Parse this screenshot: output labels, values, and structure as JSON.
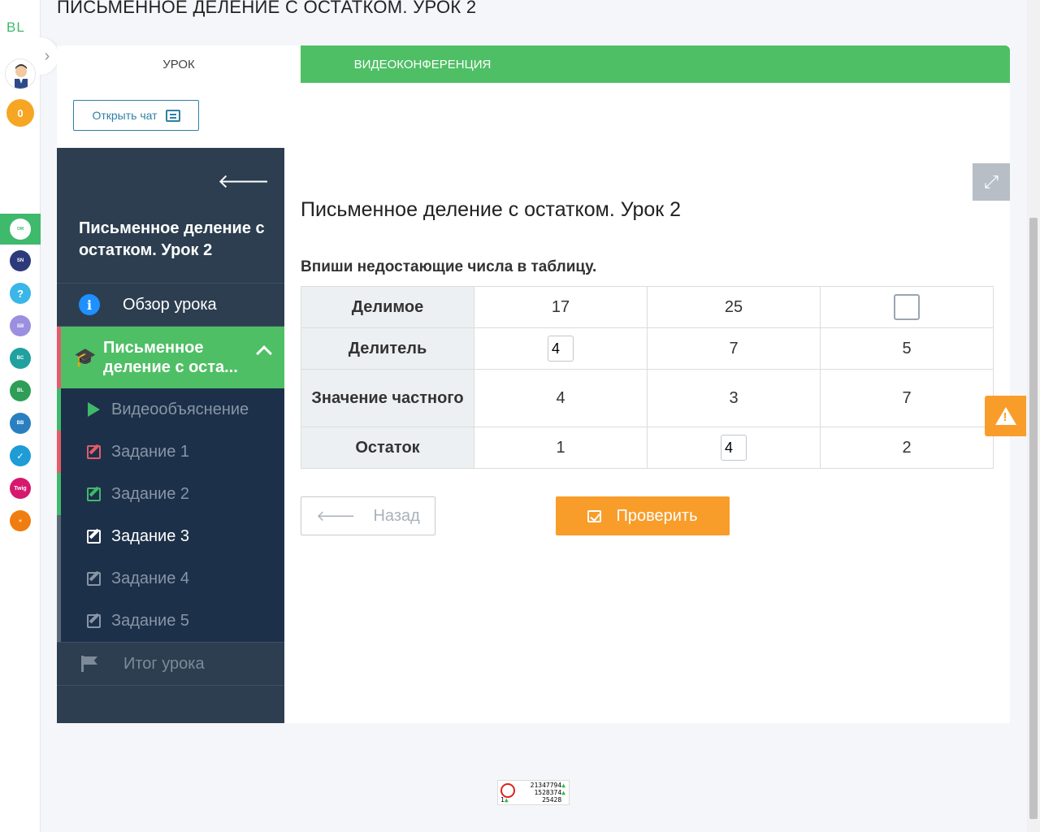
{
  "page_title": "ПИСЬМЕННОЕ ДЕЛЕНИЕ С ОСТАТКОМ. УРОК 2",
  "rail": {
    "logo": "BL",
    "coins": "0",
    "apps": [
      {
        "name": "Online Mektep",
        "color": "#3fb96b",
        "active": true
      },
      {
        "name": "Smart Nation",
        "color": "#2d3a7a"
      },
      {
        "name": "Help",
        "color": "#3ab6e8"
      },
      {
        "name": "Keyboard",
        "color": "#9b8fe0"
      },
      {
        "name": "Bilim Control",
        "color": "#21a0a0"
      },
      {
        "name": "Bilim Land",
        "color": "#2e9e57"
      },
      {
        "name": "Bilim Book",
        "color": "#2a7fc0"
      },
      {
        "name": "Test",
        "color": "#1f9bd6"
      },
      {
        "name": "Twig",
        "color": "#d6186e"
      },
      {
        "name": "Bilimsay",
        "color": "#f07d10"
      }
    ]
  },
  "tabs": {
    "lesson": "УРОК",
    "video": "ВИДЕОКОНФЕРЕНЦИЯ"
  },
  "chat_button": "Открыть чат",
  "sidebar": {
    "title": "Письменное деление с остатком. Урок 2",
    "overview": "Обзор урока",
    "current_section": "Письменное деление с оста...",
    "items": [
      {
        "label": "Видеообъяснение",
        "icon": "play-icon"
      },
      {
        "label": "Задание 1",
        "icon": "edit-icon",
        "status": "wrong"
      },
      {
        "label": "Задание 2",
        "icon": "edit-icon",
        "status": "correct"
      },
      {
        "label": "Задание 3",
        "icon": "edit-icon",
        "status": "active"
      },
      {
        "label": "Задание 4",
        "icon": "edit-icon"
      },
      {
        "label": "Задание 5",
        "icon": "edit-icon"
      }
    ],
    "summary": "Итог урока"
  },
  "content": {
    "title": "Письменное деление с остатком. Урок 2",
    "instruction": "Впиши недостающие числа в таблицу.",
    "table": {
      "rows": [
        {
          "header": "Делимое",
          "cells": [
            "17",
            "25",
            ""
          ],
          "inputs": [
            false,
            false,
            true
          ]
        },
        {
          "header": "Делитель",
          "cells": [
            "4",
            "7",
            "5"
          ],
          "inputs": [
            true,
            false,
            false
          ]
        },
        {
          "header": "Значение частного",
          "cells": [
            "4",
            "3",
            "7"
          ],
          "inputs": [
            false,
            false,
            false
          ]
        },
        {
          "header": "Остаток",
          "cells": [
            "1",
            "4",
            "2"
          ],
          "inputs": [
            false,
            true,
            false
          ]
        }
      ]
    },
    "back_button": "Назад",
    "check_button": "Проверить"
  },
  "counter": {
    "line1": "21347794",
    "line2": "1528374",
    "line3": "25428",
    "left": "1"
  }
}
